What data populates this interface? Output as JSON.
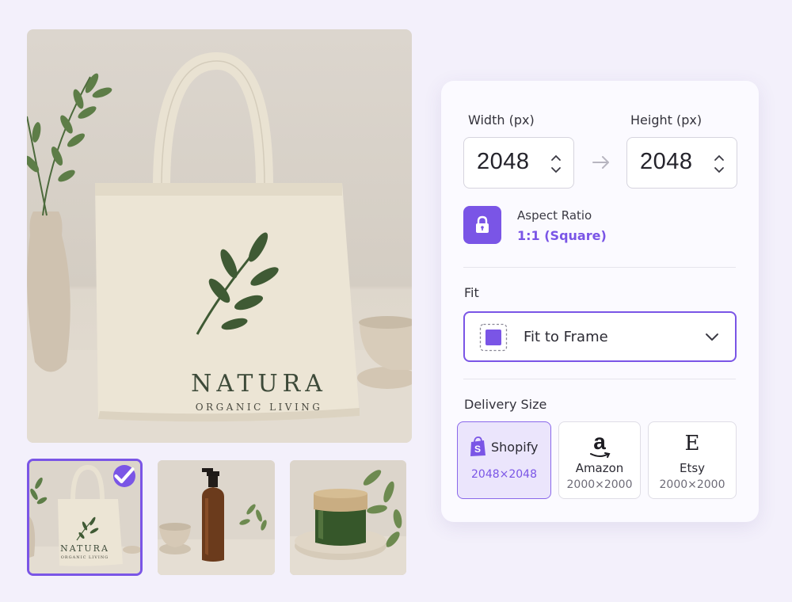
{
  "preview": {
    "brand": "NATURA",
    "tagline": "ORGANIC LIVING",
    "thumbnails": [
      {
        "name": "tote-bag",
        "selected": true
      },
      {
        "name": "amber-bottle",
        "selected": false
      },
      {
        "name": "green-jar",
        "selected": false
      }
    ]
  },
  "settings": {
    "width_label": "Width (px)",
    "width_value": "2048",
    "height_label": "Height (px)",
    "height_value": "2048",
    "aspect_label": "Aspect Ratio",
    "aspect_value": "1:1 (Square)",
    "fit_label": "Fit",
    "fit_value": "Fit to Frame",
    "delivery_label": "Delivery Size",
    "delivery_options": [
      {
        "name": "Shopify",
        "size": "2048×2048",
        "selected": true,
        "icon": "shopify-bag-icon"
      },
      {
        "name": "Amazon",
        "size": "2000×2000",
        "selected": false,
        "icon": "amazon-logo-icon"
      },
      {
        "name": "Etsy",
        "size": "2000×2000",
        "selected": false,
        "icon": "etsy-logo-icon"
      }
    ]
  },
  "colors": {
    "accent": "#7a55e6",
    "background": "#f3f0fb",
    "panel": "#fbfaff"
  }
}
